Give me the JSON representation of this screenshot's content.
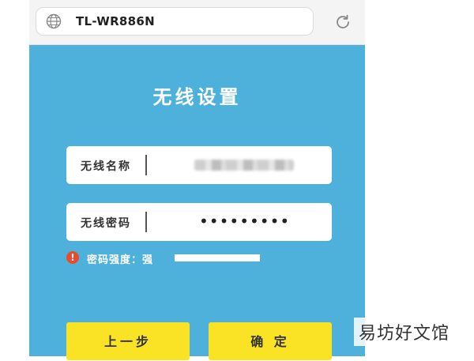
{
  "browser": {
    "url": "TL-WR886N",
    "globe_icon": "globe-icon",
    "reload_icon": "reload-icon"
  },
  "page": {
    "title": "无线设置",
    "ssid": {
      "label": "无线名称",
      "value": ""
    },
    "password": {
      "label": "无线密码",
      "value": "•••••••••"
    },
    "strength": {
      "text": "密码强度：强",
      "level_percent": 100,
      "icon": "warning-icon"
    },
    "buttons": {
      "prev": "上一步",
      "confirm": "确 定"
    }
  },
  "watermark": "易坊好文馆",
  "colors": {
    "background": "#4eb1db",
    "button": "#fae325",
    "warning": "#e94b2c"
  }
}
